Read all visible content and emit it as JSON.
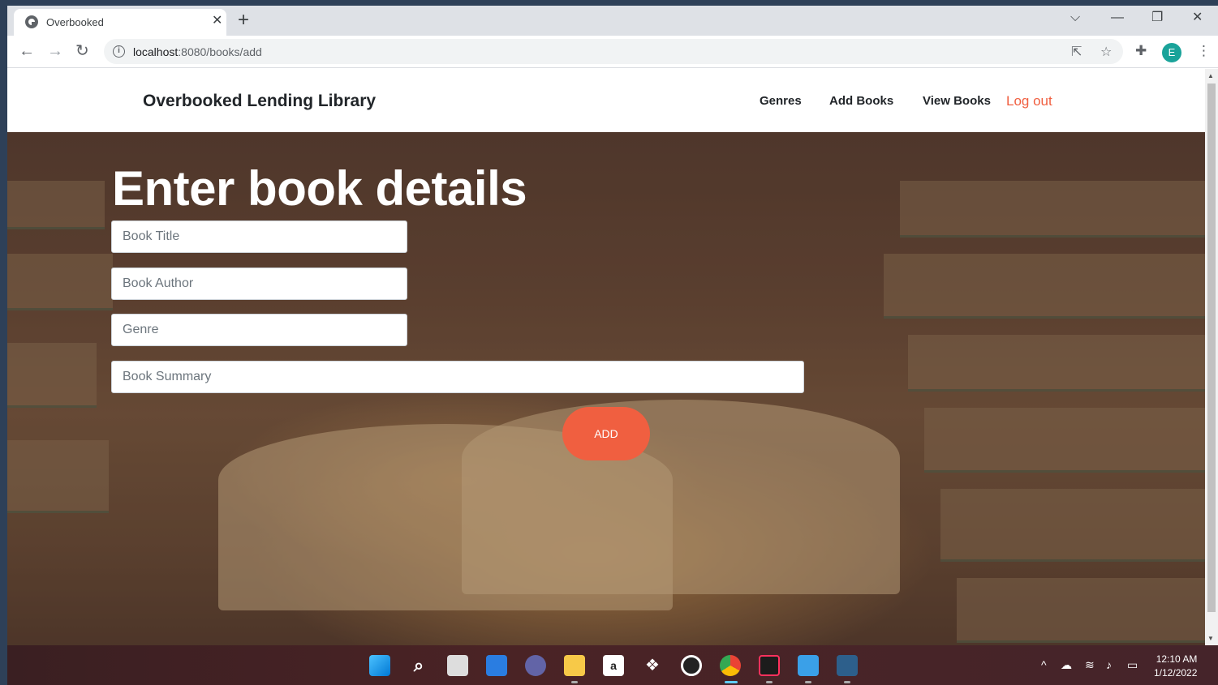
{
  "browser": {
    "tab_title": "Overbooked",
    "tab_close": "✕",
    "new_tab": "+",
    "url_host": "localhost",
    "url_path": ":8080/books/add",
    "profile_initial": "E",
    "window_controls": {
      "dropdown": "⌵",
      "minimize": "—",
      "restore": "❐",
      "close": "✕"
    }
  },
  "navbar": {
    "brand": "Overbooked Lending Library",
    "links": [
      "Genres",
      "Add Books",
      "View Books"
    ],
    "logout": "Log out"
  },
  "form": {
    "heading": "Enter book details",
    "title_placeholder": "Book Title",
    "author_placeholder": "Book Author",
    "genre_placeholder": "Genre",
    "summary_placeholder": "Book Summary",
    "submit_label": "ADD"
  },
  "taskbar": {
    "time": "12:10 AM",
    "date": "1/12/2022",
    "amazon_glyph": "a"
  },
  "colors": {
    "accent": "#f05f40",
    "profile": "#1aa39a"
  }
}
